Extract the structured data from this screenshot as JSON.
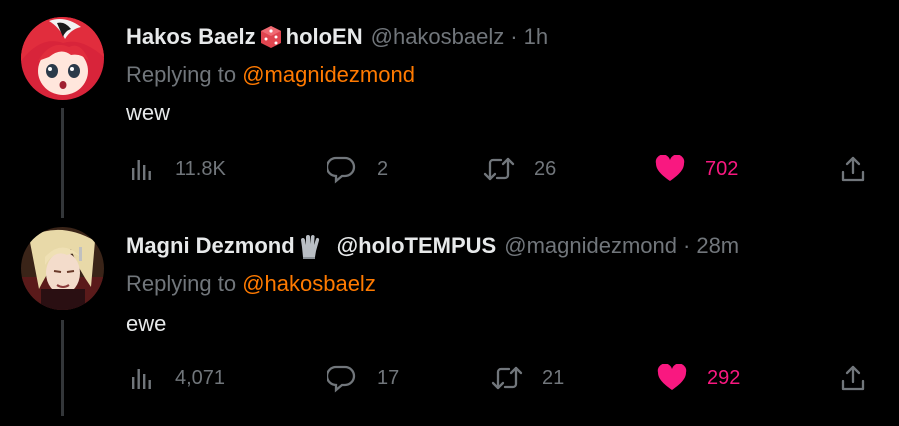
{
  "tweets": [
    {
      "name": "Hakos Baelz",
      "name_suffix": "holoEN",
      "handle": "@hakosbaelz",
      "separator": "·",
      "time": "1h",
      "replying_prefix": "Replying to ",
      "replying_to": "@magnidezmond",
      "text": "wew",
      "views": "11.8K",
      "replies": "2",
      "retweets": "26",
      "likes": "702",
      "icons": {
        "badge": "dice-emoji",
        "views": "analytics-icon",
        "reply": "reply-icon",
        "retweet": "retweet-icon",
        "like": "heart-icon",
        "share": "share-icon"
      }
    },
    {
      "name": "Magni Dezmond",
      "name_suffix": "@holoTEMPUS",
      "handle": "@magnidezmond",
      "separator": "·",
      "time": "28m",
      "replying_prefix": "Replying to ",
      "replying_to": "@hakosbaelz",
      "text": "ewe",
      "views": "4,071",
      "replies": "17",
      "retweets": "21",
      "likes": "292",
      "icons": {
        "badge": "glove-emoji",
        "views": "analytics-icon",
        "reply": "reply-icon",
        "retweet": "retweet-icon",
        "like": "heart-icon",
        "share": "share-icon"
      }
    }
  ],
  "colors": {
    "background": "#000000",
    "text": "#e7e9ea",
    "secondary": "#71767b",
    "mention": "#ff7a00",
    "like": "#f91880",
    "thread_line": "#333639"
  }
}
